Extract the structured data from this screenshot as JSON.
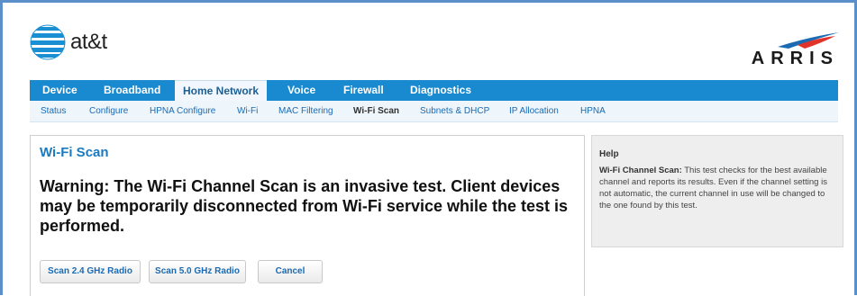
{
  "brand": {
    "att_logo_text": "at&t",
    "arris_logo_text": "ARRIS"
  },
  "main_nav": [
    {
      "label": "Device"
    },
    {
      "label": "Broadband"
    },
    {
      "label": "Home Network",
      "active": true
    },
    {
      "label": "Voice"
    },
    {
      "label": "Firewall"
    },
    {
      "label": "Diagnostics"
    }
  ],
  "sub_nav": [
    {
      "label": "Status"
    },
    {
      "label": "Configure"
    },
    {
      "label": "HPNA Configure"
    },
    {
      "label": "Wi-Fi"
    },
    {
      "label": "MAC Filtering"
    },
    {
      "label": "Wi-Fi Scan",
      "active": true
    },
    {
      "label": "Subnets & DHCP"
    },
    {
      "label": "IP Allocation"
    },
    {
      "label": "HPNA"
    }
  ],
  "content": {
    "title": "Wi-Fi Scan",
    "warning": "Warning: The Wi-Fi Channel Scan is an invasive test. Client devices may be temporarily disconnected from Wi-Fi service while the test is performed.",
    "buttons": {
      "scan24": "Scan 2.4 GHz Radio",
      "scan50": "Scan 5.0 GHz Radio",
      "cancel": "Cancel"
    }
  },
  "help": {
    "title": "Help",
    "term": "Wi-Fi Channel Scan:",
    "text": " This test checks for the best available channel and reports its results. Even if the channel setting is not automatic, the current channel in use will be changed to the one found by this test."
  },
  "colors": {
    "nav_blue": "#1a8ad0",
    "link_blue": "#1a6bb3",
    "title_blue": "#1a7ac0",
    "frame_blue": "#5b8fc9"
  }
}
